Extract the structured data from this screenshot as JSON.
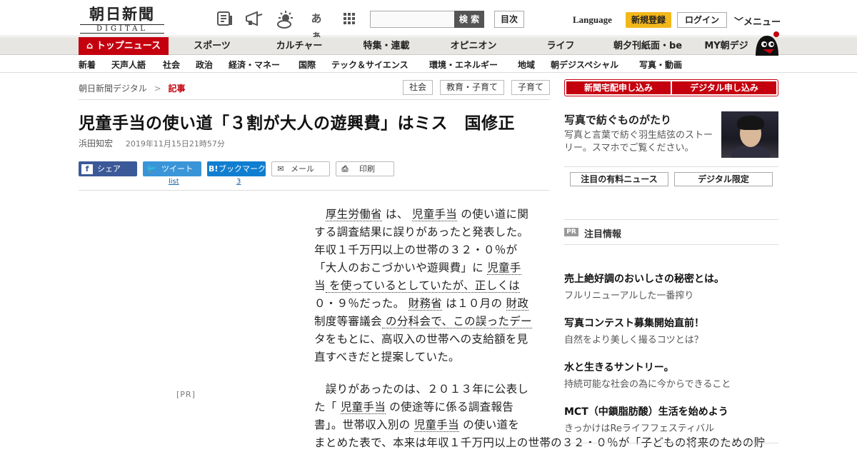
{
  "header": {
    "logo_jp": "朝日新聞",
    "logo_en": "DIGITAL",
    "search_placeholder": "",
    "search_label": "検 索",
    "mokuji_label": "目次",
    "language_label": "Language",
    "register_label": "新規登録",
    "login_label": "ログイン",
    "menu_label": "メニュー",
    "kana_icon": "あぁ",
    "icons": [
      "newspaper-icon",
      "megaphone-icon",
      "weather-icon",
      "font-size-icon",
      "grid-icon"
    ]
  },
  "nav_primary": [
    "トップニュース",
    "スポーツ",
    "カルチャー",
    "特集・連載",
    "オピニオン",
    "ライフ",
    "朝夕刊紙面・be",
    "MY朝デジ"
  ],
  "nav_secondary": [
    "新着",
    "天声人語",
    "社会",
    "政治",
    "経済・マネー",
    "国際",
    "テック＆サイエンス",
    "環境・エネルギー",
    "地域",
    "朝デジスペシャル",
    "写真・動画"
  ],
  "breadcrumb": {
    "home": "朝日新聞デジタル",
    "separator": ">",
    "current": "記事"
  },
  "tags": [
    "社会",
    "教育・子育て",
    "子育て"
  ],
  "article": {
    "title": "児童手当の使い道「３割が大人の遊興費」はミス　国修正",
    "author": "浜田知宏",
    "date": "2019年11月15日21時57分",
    "share": {
      "facebook": "シェア",
      "twitter": "ツイート",
      "twitter_count": "list",
      "hatena": "ブックマーク",
      "hatena_count": "3",
      "mail": "メール",
      "print": "印刷"
    },
    "pr_label": "[PR]",
    "p1_lines": [
      [
        "　",
        "厚生労働省",
        " は、 ",
        "児童手当",
        " の使い道に関"
      ],
      [
        "する調査結果に誤りがあったと発表した。"
      ],
      [
        "年収１千万円以上の世帯の３２・０％が"
      ],
      [
        "「大人のおこづかいや遊興費」に ",
        "児童手"
      ],
      [
        "当",
        " を使っているとしていたが、正しくは"
      ],
      [
        "０・９％だった。 ",
        "財務省",
        " は１０月の ",
        "財政"
      ],
      [
        "制度等審議会",
        " の分科会で、この誤ったデー"
      ],
      [
        "タをもとに、高収入の世帯への支給額を見"
      ],
      [
        "直すべきだと提案していた。"
      ]
    ],
    "p2_lines": [
      [
        "　誤りがあったのは、２０１３年に公表し"
      ],
      [
        "た「 ",
        "児童手当",
        " の使途等に係る調査報告"
      ],
      [
        "書」。世帯収入別の ",
        "児童手当",
        " の使い道を"
      ],
      [
        "まとめた表で、本来は年収１千万円以上の世帯の３２・０％が「子どもの将来のための貯"
      ]
    ]
  },
  "sidebar": {
    "btn_delivery": "新聞宅配申し込み",
    "btn_digital": "デジタル申し込み",
    "feature_title": "写真で紡ぐものがたり",
    "feature_desc": "写真と言葉で紡ぐ羽生結弦のストーリー。スマホでご覧ください。",
    "btn_paid_news": "注目の有料ニュース",
    "btn_digital_only": "デジタル限定",
    "pr_badge": "PR",
    "pr_heading": "注目情報",
    "ads": [
      {
        "title": "売上絶好調のおいしさの秘密とは。",
        "desc": "フルリニューアルした一番搾り"
      },
      {
        "title": "写真コンテスト募集開始直前！",
        "desc": "自然をより美しく撮るコツとは？"
      },
      {
        "title": "水と生きるサントリー。",
        "desc": "持続可能な社会の為に今からできること"
      },
      {
        "title": "MCT（中鎖脂肪酸）生活を始めよう",
        "desc": "きっかけはReライフフェスティバル"
      }
    ]
  }
}
